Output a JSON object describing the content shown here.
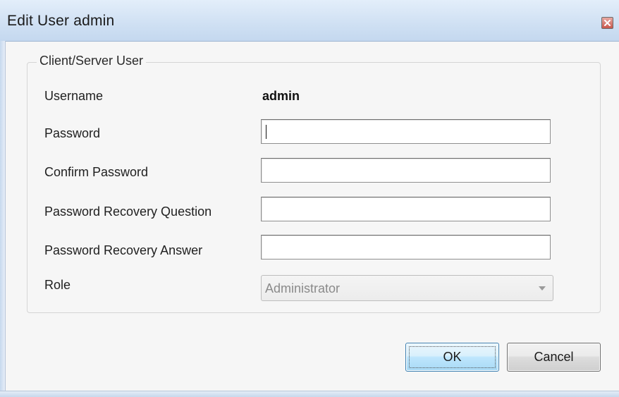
{
  "window": {
    "title": "Edit User admin",
    "close_icon": "close-icon"
  },
  "group": {
    "legend": "Client/Server User"
  },
  "fields": {
    "username_label": "Username",
    "username_value": "admin",
    "password_label": "Password",
    "password_value": "",
    "confirm_password_label": "Confirm Password",
    "confirm_password_value": "",
    "recovery_question_label": "Password Recovery Question",
    "recovery_question_value": "",
    "recovery_answer_label": "Password Recovery Answer",
    "recovery_answer_value": "",
    "role_label": "Role",
    "role_value": "Administrator",
    "role_enabled": false
  },
  "buttons": {
    "ok_label": "OK",
    "cancel_label": "Cancel"
  },
  "colors": {
    "titlebar": "#cfe0f3",
    "ok_accent": "#3c7fb1",
    "close_red": "#c8574c"
  }
}
